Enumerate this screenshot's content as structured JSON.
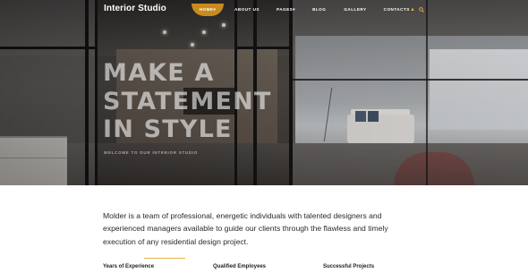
{
  "header": {
    "brand": "Interior Studio",
    "nav": [
      {
        "label": "HOME",
        "active": true,
        "has_dropdown": true
      },
      {
        "label": "ABOUT US",
        "active": false,
        "has_dropdown": false
      },
      {
        "label": "PAGES",
        "active": false,
        "has_dropdown": true
      },
      {
        "label": "BLOG",
        "active": false,
        "has_dropdown": false
      },
      {
        "label": "GALLERY",
        "active": false,
        "has_dropdown": false
      },
      {
        "label": "CONTACTS",
        "active": false,
        "has_dropdown": false
      }
    ],
    "icons": [
      "user-icon",
      "search-icon"
    ]
  },
  "hero": {
    "headline": [
      "MAKE A",
      "STATEMENT",
      "IN STYLE"
    ],
    "subheadline": "WELCOME TO OUR INTERIOR STUDIO"
  },
  "intro": {
    "text": "Molder is a team of professional, energetic individuals with talented designers and experienced managers available to guide our clients through the flawless and timely execution of any residential design project."
  },
  "stats": [
    {
      "label": "Years of Experience"
    },
    {
      "label": "Qualified Employees"
    },
    {
      "label": "Successful Projects"
    }
  ],
  "colors": {
    "accent": "#c88b1e",
    "divider": "#e6b54a",
    "text": "#2a2a2a"
  }
}
